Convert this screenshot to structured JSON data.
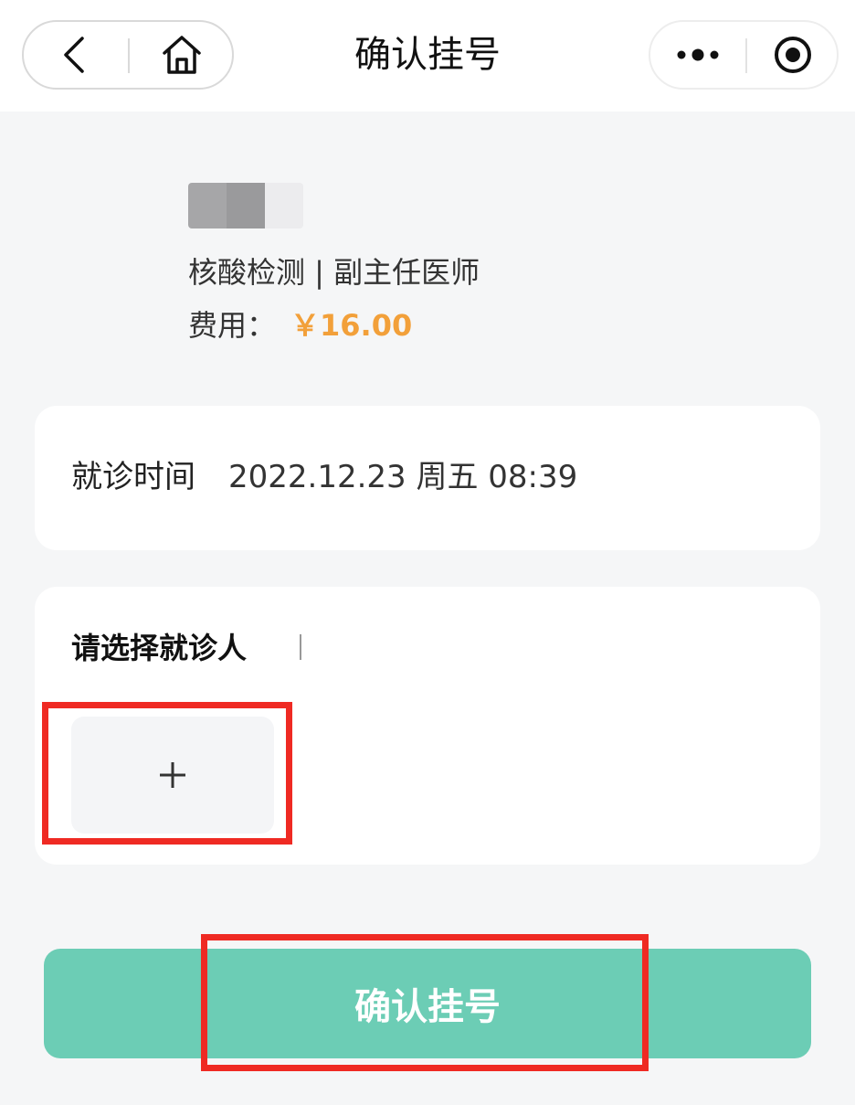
{
  "topbar": {
    "title": "确认挂号",
    "back_icon": "chevron-left-icon",
    "home_icon": "home-icon",
    "more_icon": "more-dots-icon",
    "close_icon": "target-circle-icon"
  },
  "doctor": {
    "department": "核酸检测",
    "title": "副主任医师",
    "department_line": "核酸检测 | 副主任医师",
    "fee_label": "费用：",
    "fee_value": "￥16.00"
  },
  "visit": {
    "label": "就诊时间",
    "datetime": "2022.12.23 周五 08:39"
  },
  "patient": {
    "title": "请选择就诊人",
    "add_symbol": "+"
  },
  "confirm": {
    "label": "确认挂号"
  },
  "colors": {
    "accent": "#6ccdb5",
    "fee": "#f2a03a",
    "highlight": "#ef2a23",
    "background": "#f5f6f7"
  }
}
